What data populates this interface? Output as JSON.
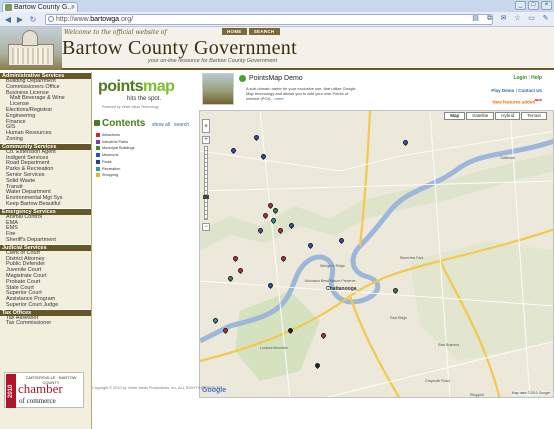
{
  "browser": {
    "tab_title": "Bartow County G...",
    "url_prefix": "http://www.",
    "url_domain": "bartowga",
    "url_suffix": ".org/",
    "icons": [
      "document-icon",
      "tab-icon",
      "gmail-icon",
      "star-icon",
      "page-menu-icon",
      "wrench-icon"
    ]
  },
  "header": {
    "welcome": "Welcome to the official website of",
    "title": "Bartow County Government",
    "tagline": "your on-line resource for Bartow County Government",
    "nav": [
      "HOME",
      "SEARCH"
    ]
  },
  "sidebar": {
    "sections": [
      {
        "title": "Administrative Services",
        "items": [
          {
            "label": "Building Department",
            "sub": false
          },
          {
            "label": "Commissioners Office",
            "sub": false
          },
          {
            "label": "Business License",
            "sub": false
          },
          {
            "label": "Malt Beverage & Wine",
            "sub": true
          },
          {
            "label": "License",
            "sub": true
          },
          {
            "label": "Elections/Registrar",
            "sub": false
          },
          {
            "label": "Engineering",
            "sub": false
          },
          {
            "label": "Finance",
            "sub": false
          },
          {
            "label": "GIS",
            "sub": false
          },
          {
            "label": "Human Resources",
            "sub": false
          },
          {
            "label": "Zoning",
            "sub": false
          }
        ]
      },
      {
        "title": "Community Services",
        "items": [
          {
            "label": "Co. Extension Agent",
            "sub": false
          },
          {
            "label": "Indigent Services",
            "sub": false
          },
          {
            "label": "Road Department",
            "sub": false
          },
          {
            "label": "Parks & Recreation",
            "sub": false
          },
          {
            "label": "Senior Services",
            "sub": false
          },
          {
            "label": "Solid Waste",
            "sub": false
          },
          {
            "label": "Transit",
            "sub": false
          },
          {
            "label": "Water Department",
            "sub": false
          },
          {
            "label": "Environmental Mgt Sys",
            "sub": false
          },
          {
            "label": "Keep Bartow Beautiful",
            "sub": false
          }
        ]
      },
      {
        "title": "Emergency Services",
        "items": [
          {
            "label": "Animal Control",
            "sub": false
          },
          {
            "label": "EMA",
            "sub": false
          },
          {
            "label": "EMS",
            "sub": false
          },
          {
            "label": "Fire",
            "sub": false
          },
          {
            "label": "Sheriff's Department",
            "sub": false
          }
        ]
      },
      {
        "title": "Judicial Services",
        "items": [
          {
            "label": "Clerk of Court",
            "sub": false
          },
          {
            "label": "District Attorney",
            "sub": false
          },
          {
            "label": "Public Defender",
            "sub": false
          },
          {
            "label": "Juvenile Court",
            "sub": false
          },
          {
            "label": "Magistrate Court",
            "sub": false
          },
          {
            "label": "Probate Court",
            "sub": false
          },
          {
            "label": "State Court",
            "sub": false
          },
          {
            "label": "Superior Court",
            "sub": false
          },
          {
            "label": "Assistance Program",
            "sub": false
          },
          {
            "label": "Superior Court Judge",
            "sub": false
          }
        ]
      },
      {
        "title": "Tax Offices",
        "items": [
          {
            "label": "Tax Assessor",
            "sub": false
          },
          {
            "label": "Tax Commissioner",
            "sub": false
          }
        ]
      }
    ],
    "chamber": {
      "year": "2010",
      "town": "CARTERSVILLE · BARTOW COUNTY",
      "line1": "chamber",
      "line2": "of commerce"
    }
  },
  "pointsmap": {
    "logo_left": "points",
    "logo_right": "map",
    "tagline": "hits the spot.",
    "powered": "Powered by Vinter Ideas Technology",
    "contents_title": "Contents",
    "show_all": "show all",
    "search": "search",
    "categories": [
      {
        "label": "Attractions",
        "color": "#cc2a2a"
      },
      {
        "label": "Industrial Parks",
        "color": "#7a3fa0"
      },
      {
        "label": "Municipal Buildings",
        "color": "#3a8a3a"
      },
      {
        "label": "Museums",
        "color": "#2a4fcc"
      },
      {
        "label": "Parks",
        "color": "#3a3a8a"
      },
      {
        "label": "Recreation",
        "color": "#2aa0a0"
      },
      {
        "label": "Shopping",
        "color": "#d0c020"
      }
    ]
  },
  "demo": {
    "title": "PointsMap Demo",
    "description": "A sub-domain name for your exclusive use, that utilize Google Map technology and allows you to add your own Points of Interest (POI)...",
    "more": "more",
    "login": "Login",
    "help": "Help",
    "play_demo": "Play Demo",
    "contact_us": "Contact Us",
    "new_features": "New features added",
    "new_mark": "NEW"
  },
  "map": {
    "types": [
      "Map",
      "Satellite",
      "Hybrid",
      "Terrain"
    ],
    "active_type": "Map",
    "google": "Google",
    "copyright": "Map data ©2010 Google",
    "labels": [
      "Chattanooga",
      "Moccasin Bend Nature Preserve",
      "East Brainerd",
      "Riverview Park",
      "Lookout Mountain",
      "Ooltewah",
      "Graysville Road",
      "Stringer's Ridge",
      "East Ridge",
      "Ringgold"
    ]
  },
  "footer": {
    "copyright": "Copyright © 2010 by Vinter Ideas Productions, Inc. ALL RIGHTS RESERVED."
  }
}
